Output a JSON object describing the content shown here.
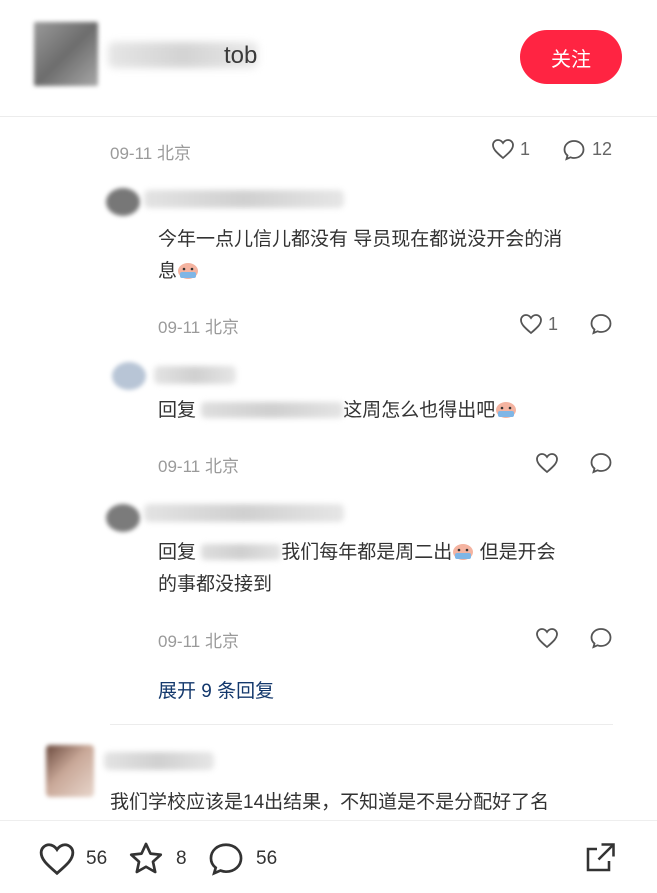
{
  "header": {
    "user_name_visible_tail": "tob",
    "follow_label": "关注"
  },
  "main_comment": {
    "date": "09-11",
    "location": "北京",
    "likes": "1",
    "replies": "12"
  },
  "replies": [
    {
      "text_line1": "今年一点儿信儿都没有 导员现在都说没开会的消",
      "text_line2": "息",
      "date": "09-11",
      "location": "北京",
      "likes": "1"
    },
    {
      "reply_prefix": "回复",
      "text": "这周怎么也得出吧",
      "date": "09-11",
      "location": "北京"
    },
    {
      "reply_prefix": "回复",
      "text_part1": "我们每年都是周二出",
      "text_part2": " 但是开会",
      "text_line2": "的事都没接到",
      "date": "09-11",
      "location": "北京"
    }
  ],
  "expand_label": "展开 9 条回复",
  "next_comment": {
    "text": "我们学校应该是14出结果，不知道是不是分配好了名"
  },
  "bottom_bar": {
    "likes": "56",
    "stars": "8",
    "comments": "56"
  },
  "colors": {
    "accent": "#ff2442",
    "link": "#13386c"
  }
}
